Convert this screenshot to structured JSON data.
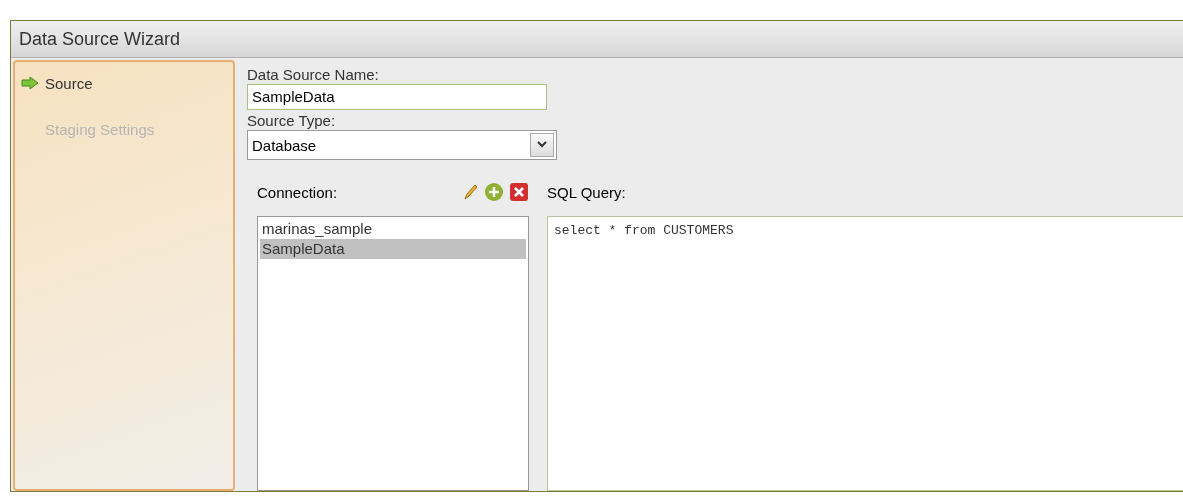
{
  "window": {
    "title": "Data Source Wizard"
  },
  "steps": [
    {
      "label": "Source",
      "selected": true
    },
    {
      "label": "Staging Settings",
      "selected": false
    }
  ],
  "name_field": {
    "label": "Data Source Name:",
    "value": "SampleData"
  },
  "type_field": {
    "label": "Source Type:",
    "value": "Database"
  },
  "connection": {
    "label": "Connection:",
    "items": [
      {
        "label": "marinas_sample",
        "selected": false
      },
      {
        "label": "SampleData",
        "selected": true
      }
    ]
  },
  "query": {
    "label": "SQL Query:",
    "value": "select * from CUSTOMERS"
  }
}
